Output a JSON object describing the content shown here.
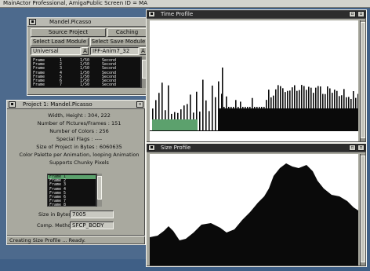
{
  "screen_title": "MainActor Professional, AmigaPublic Screen ID = MA",
  "mandel_window": {
    "title": "Mandel.Picasso",
    "source_project_button": "Source Project",
    "caching_button": "Caching",
    "select_load_module_button": "Select Load Module",
    "select_save_module_button": "Select Save Module",
    "load_module_value": "Universal",
    "save_module_value": "IFF-Anim7_32",
    "frames": [
      {
        "name": "Frame",
        "num": "1",
        "time": "1/50",
        "unit": "Second"
      },
      {
        "name": "Frame",
        "num": "2",
        "time": "1/50",
        "unit": "Second"
      },
      {
        "name": "Frame",
        "num": "3",
        "time": "1/50",
        "unit": "Second"
      },
      {
        "name": "Frame",
        "num": "4",
        "time": "1/50",
        "unit": "Second"
      },
      {
        "name": "Frame",
        "num": "5",
        "time": "1/50",
        "unit": "Second"
      },
      {
        "name": "Frame",
        "num": "6",
        "time": "1/50",
        "unit": "Second"
      },
      {
        "name": "Frame",
        "num": "7",
        "time": "1/50",
        "unit": "Second"
      }
    ]
  },
  "project_window": {
    "title": "Project 1: Mandel.Picasso",
    "info": [
      "Width, Height : 304, 222",
      "Number of Pictures/Frames : 151",
      "Number of Colors : 256",
      "Special Flags : ----",
      "Size of Project in Bytes : 6060635",
      "Color Palette per Animation, looping Animation",
      "Supports Chunky Pixels"
    ],
    "frames": [
      "Frame 1",
      "Frame 2",
      "Frame 3",
      "Frame 4",
      "Frame 5",
      "Frame 6",
      "Frame 7",
      "Frame 8"
    ],
    "selected_frame_index": 0,
    "size_label": "Size in Bytes",
    "size_value": "7005",
    "comp_label": "Comp. Method",
    "comp_value": "SFCP_BODY"
  },
  "status_text": "Creating Size Profile ... Ready.",
  "time_window": {
    "title": "Time Profile"
  },
  "size_window": {
    "title": "Size Profile"
  },
  "colors": {
    "accent_green": "#5ca16d",
    "chart_black": "#0a0a0a",
    "chart_bg": "#ffffff"
  }
}
